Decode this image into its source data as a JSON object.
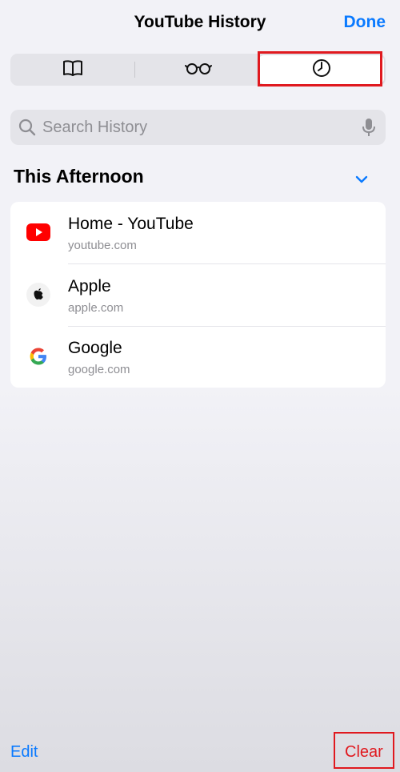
{
  "header": {
    "title": "YouTube History",
    "done_label": "Done"
  },
  "segments": [
    {
      "icon": "book-icon",
      "selected": false
    },
    {
      "icon": "glasses-icon",
      "selected": false
    },
    {
      "icon": "clock-icon",
      "selected": true
    }
  ],
  "search": {
    "placeholder": "Search History",
    "value": ""
  },
  "section": {
    "title": "This Afternoon"
  },
  "history": [
    {
      "title": "Home - YouTube",
      "url": "youtube.com",
      "icon": "youtube-favicon"
    },
    {
      "title": "Apple",
      "url": "apple.com",
      "icon": "apple-favicon"
    },
    {
      "title": "Google",
      "url": "google.com",
      "icon": "google-favicon"
    }
  ],
  "footer": {
    "edit_label": "Edit",
    "clear_label": "Clear"
  },
  "colors": {
    "accent": "#0a7aff",
    "destructive": "#e0191f",
    "highlight_box": "#e0191f",
    "youtube_red": "#ff0000"
  }
}
